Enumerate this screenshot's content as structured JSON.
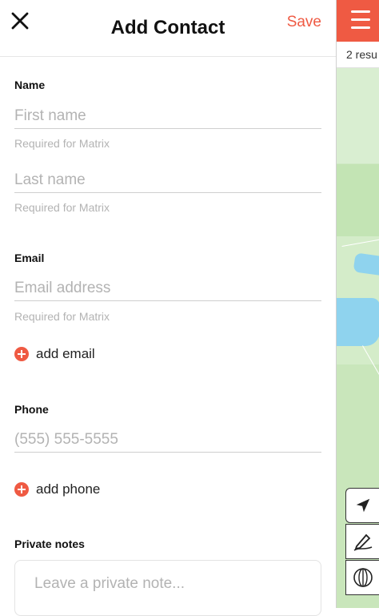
{
  "header": {
    "title": "Add Contact",
    "save_label": "Save"
  },
  "name_section": {
    "label": "Name",
    "first_name_placeholder": "First name",
    "first_name_helper": "Required for Matrix",
    "last_name_placeholder": "Last name",
    "last_name_helper": "Required for Matrix"
  },
  "email_section": {
    "label": "Email",
    "email_placeholder": "Email address",
    "email_helper": "Required for Matrix",
    "add_label": "add email"
  },
  "phone_section": {
    "label": "Phone",
    "phone_placeholder": "(555) 555-5555",
    "add_label": "add phone"
  },
  "notes_section": {
    "label": "Private notes",
    "placeholder": "Leave a private note..."
  },
  "map_panel": {
    "results_text": "2 resu"
  },
  "colors": {
    "accent": "#ef5a43",
    "placeholder": "#b3b3b3"
  },
  "icons": [
    "close-icon",
    "menu-icon",
    "location-arrow-icon",
    "pencil-icon",
    "globe-icon",
    "add-icon"
  ]
}
